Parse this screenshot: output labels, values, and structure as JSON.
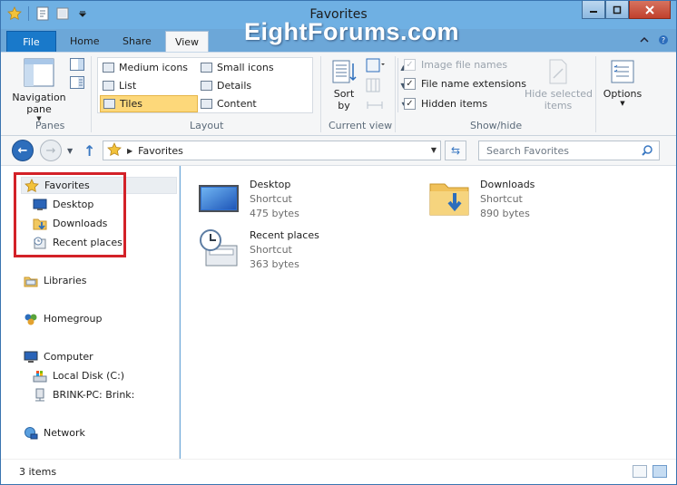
{
  "window": {
    "title": "Favorites"
  },
  "watermark": "EightForums.com",
  "ribbon_tabs": [
    {
      "label": "File"
    },
    {
      "label": "Home"
    },
    {
      "label": "Share"
    },
    {
      "label": "View"
    }
  ],
  "ribbon": {
    "panes": {
      "nav_pane_label": "Navigation\npane",
      "group_label": "Panes"
    },
    "layout": {
      "group_label": "Layout",
      "items": [
        {
          "label": "Medium icons"
        },
        {
          "label": "Small icons"
        },
        {
          "label": "List"
        },
        {
          "label": "Details"
        },
        {
          "label": "Tiles"
        },
        {
          "label": "Content"
        }
      ],
      "selected": "Tiles"
    },
    "current_view": {
      "sort_label": "Sort\nby",
      "group_label": "Current view"
    },
    "show_hide": {
      "group_label": "Show/hide",
      "checks": [
        {
          "label": "Image file names",
          "checked": true,
          "disabled": true
        },
        {
          "label": "File name extensions",
          "checked": true,
          "disabled": false
        },
        {
          "label": "Hidden items",
          "checked": true,
          "disabled": false
        }
      ],
      "hide_selected_label": "Hide selected\nitems"
    },
    "options_label": "Options"
  },
  "address": {
    "current": "Favorites",
    "search_placeholder": "Search Favorites"
  },
  "nav_tree": [
    {
      "label": "Favorites"
    },
    {
      "label": "Desktop"
    },
    {
      "label": "Downloads"
    },
    {
      "label": "Recent places"
    },
    {
      "label": "Libraries"
    },
    {
      "label": "Homegroup"
    },
    {
      "label": "Computer"
    },
    {
      "label": "Local Disk (C:)"
    },
    {
      "label": "BRINK-PC: Brink:"
    },
    {
      "label": "Network"
    }
  ],
  "tiles": [
    {
      "name": "Desktop",
      "type": "Shortcut",
      "size": "475 bytes"
    },
    {
      "name": "Downloads",
      "type": "Shortcut",
      "size": "890 bytes"
    },
    {
      "name": "Recent places",
      "type": "Shortcut",
      "size": "363 bytes"
    }
  ],
  "status": {
    "item_count": "3 items"
  },
  "colors": {
    "ribbon_bg": "#f5f6f7",
    "title_bg": "#6fb0e3",
    "selected_layout": "#fdd87a",
    "highlight_box": "#d32128"
  }
}
